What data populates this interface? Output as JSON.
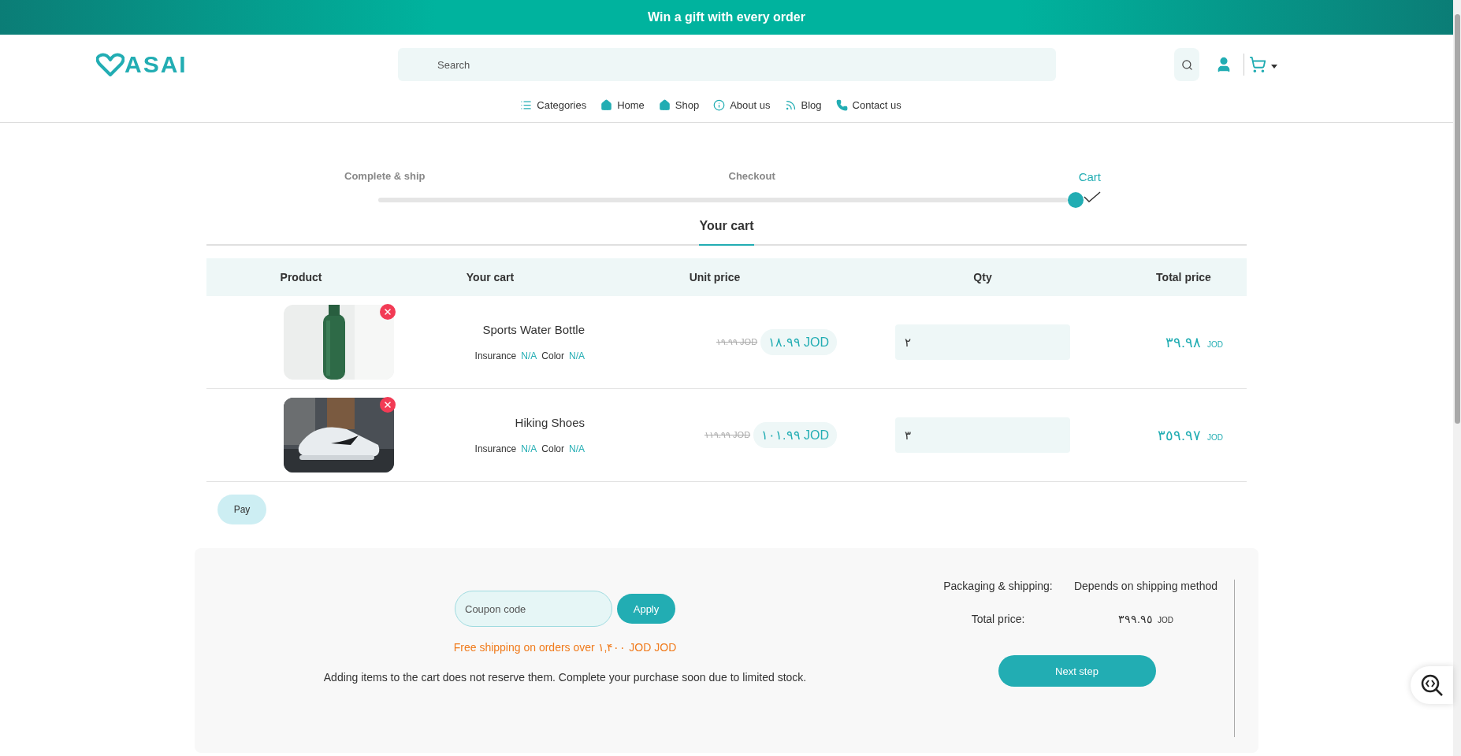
{
  "banner": {
    "text": "Win a gift with every order"
  },
  "header": {
    "logo_text": "ASAI",
    "search": {
      "placeholder": "Search"
    }
  },
  "nav": [
    {
      "label": "Categories",
      "kind": "list"
    },
    {
      "label": "Home",
      "kind": "home"
    },
    {
      "label": "Shop",
      "kind": "home"
    },
    {
      "label": "About us",
      "kind": "info"
    },
    {
      "label": "Blog",
      "kind": "rss"
    },
    {
      "label": "Contact us",
      "kind": "phone"
    }
  ],
  "steps": [
    {
      "label": "Complete & ship",
      "selected": false
    },
    {
      "label": "Checkout",
      "selected": false
    },
    {
      "label": "Cart",
      "selected": true
    }
  ],
  "section_title": "Your cart",
  "table": {
    "columns": [
      "Product",
      "Your cart",
      "Unit price",
      "Qty",
      "Total price"
    ],
    "rows": [
      {
        "kind": "bottle",
        "name": "Sports Water Bottle",
        "insurance_label": "Insurance",
        "insurance": "N/A",
        "color_label": "Color",
        "color_value": "N/A",
        "old_price": "١٩.٩٩ JOD",
        "price": "١٨.٩٩ JOD",
        "qty": "٢",
        "total": "٣٩.٩٨",
        "currency": "JOD"
      },
      {
        "kind": "shoe",
        "name": "Hiking Shoes",
        "insurance_label": "Insurance",
        "insurance": "N/A",
        "color_label": "Color",
        "color_value": "N/A",
        "old_price": "١١٩.٩٩ JOD",
        "price": "١٠١.٩٩ JOD",
        "qty": "٣",
        "total": "٣٥٩.٩٧",
        "currency": "JOD"
      }
    ]
  },
  "pay_button": "Pay",
  "summary": {
    "coupon": {
      "placeholder": "Coupon code"
    },
    "apply_button": "Apply",
    "free_shipping": "Free shipping on orders over ١,۴٠٠ JOD JOD",
    "notice": "Adding items to the cart does not reserve them. Complete your purchase soon due to limited stock.",
    "shipping_label": "Packaging & shipping:",
    "shipping_value": "Depends on shipping method",
    "total_label": "Total price:",
    "total_value": "٣٩٩.٩٥",
    "total_currency": "JOD",
    "next_button": "Next step"
  }
}
